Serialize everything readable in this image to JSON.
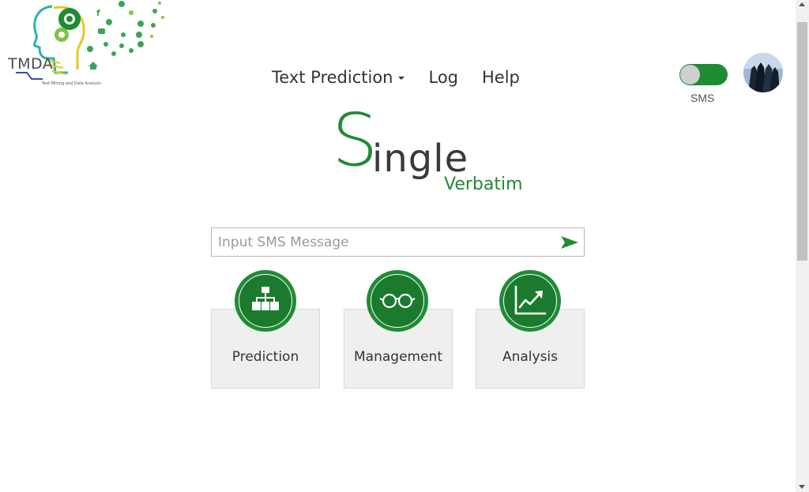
{
  "logo": {
    "text": "TMDA",
    "subtext": "Text Mining and Data Analysis"
  },
  "nav": {
    "items": [
      {
        "label": "Text Prediction"
      },
      {
        "label": "Log"
      },
      {
        "label": "Help"
      }
    ]
  },
  "toggle": {
    "label": "SMS",
    "state": "on"
  },
  "title": {
    "first_letter": "S",
    "rest": "ingle",
    "subtitle": "Verbatim"
  },
  "search": {
    "placeholder": "Input SMS Message",
    "value": ""
  },
  "cards": [
    {
      "label": "Prediction",
      "icon": "hierarchy-icon"
    },
    {
      "label": "Management",
      "icon": "glasses-icon"
    },
    {
      "label": "Analysis",
      "icon": "trend-chart-icon"
    }
  ],
  "colors": {
    "accent": "#1f8c34",
    "card_bg": "#efefef",
    "text": "#333333"
  }
}
